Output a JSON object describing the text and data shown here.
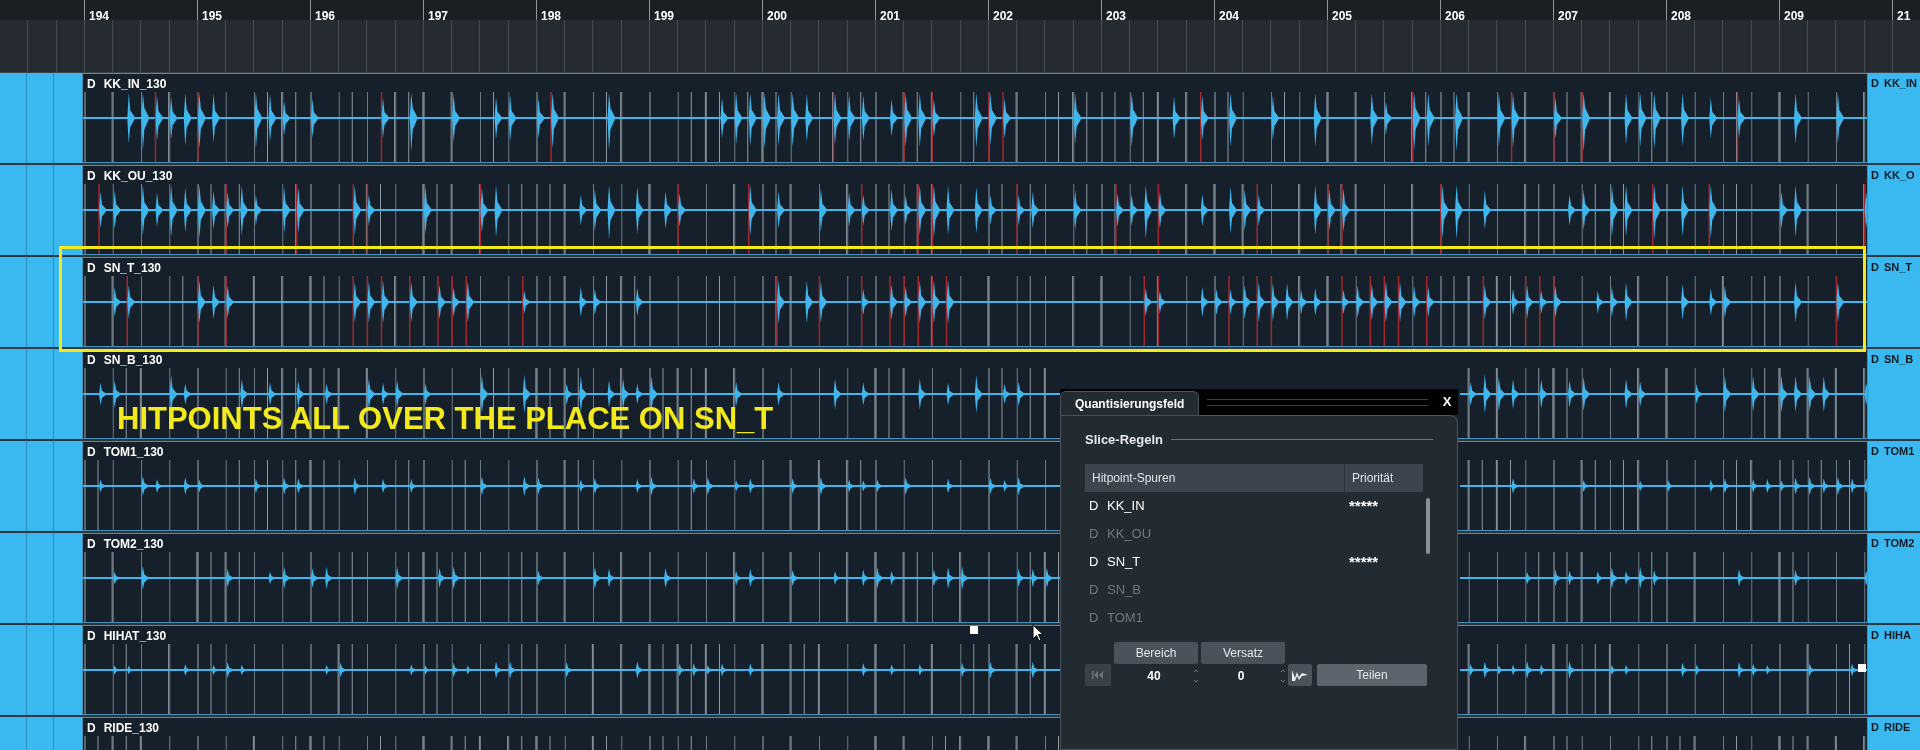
{
  "ruler": {
    "bars": [
      "194",
      "195",
      "196",
      "197",
      "198",
      "199",
      "200",
      "201",
      "202",
      "203",
      "204",
      "205",
      "206",
      "207",
      "208",
      "209",
      "21"
    ]
  },
  "tracks": [
    {
      "prefix": "D",
      "name": "KK_IN_130",
      "edge_prefix": "D",
      "edge_label": "KK_IN",
      "highlighted": false
    },
    {
      "prefix": "D",
      "name": "KK_OU_130",
      "edge_prefix": "D",
      "edge_label": "KK_O",
      "highlighted": false
    },
    {
      "prefix": "D",
      "name": "SN_T_130",
      "edge_prefix": "D",
      "edge_label": "SN_T",
      "highlighted": true
    },
    {
      "prefix": "D",
      "name": "SN_B_130",
      "edge_prefix": "D",
      "edge_label": "SN_B",
      "highlighted": false,
      "annotation": "HITPOINTS ALL OVER THE PLACE ON SN_T"
    },
    {
      "prefix": "D",
      "name": "TOM1_130",
      "edge_prefix": "D",
      "edge_label": "TOM1",
      "highlighted": false
    },
    {
      "prefix": "D",
      "name": "TOM2_130",
      "edge_prefix": "D",
      "edge_label": "TOM2",
      "highlighted": false
    },
    {
      "prefix": "D",
      "name": "HIHAT_130",
      "edge_prefix": "D",
      "edge_label": "HIHA",
      "highlighted": false
    },
    {
      "prefix": "D",
      "name": "RIDE_130",
      "edge_prefix": "D",
      "edge_label": "RIDE",
      "highlighted": false
    }
  ],
  "panel": {
    "tab": "Quantisierungsfeld",
    "close": "X",
    "section": "Slice-Regeln",
    "columns": [
      "Hitpoint-Spuren",
      "Priorität"
    ],
    "rows": [
      {
        "prefix": "D",
        "name": "KK_IN",
        "priority": "*****",
        "enabled": true
      },
      {
        "prefix": "D",
        "name": "KK_OU",
        "enabled": false
      },
      {
        "prefix": "D",
        "name": "SN_T",
        "priority": "*****",
        "enabled": true
      },
      {
        "prefix": "D",
        "name": "SN_B",
        "enabled": false
      },
      {
        "prefix": "D",
        "name": "TOM1",
        "enabled": false
      }
    ],
    "controls": {
      "range_label": "Bereich",
      "range_value": "40",
      "offset_label": "Versatz",
      "offset_value": "0",
      "split_button": "Teilen",
      "rewind_disabled": true
    }
  }
}
